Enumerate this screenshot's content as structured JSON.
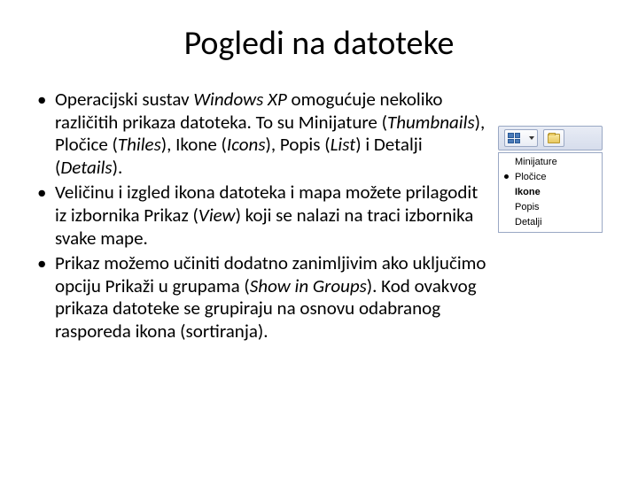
{
  "title": "Pogledi na datoteke",
  "bullets": [
    {
      "pre": "Operacijski sustav ",
      "i1": "Windows XP",
      "mid1": " omogućuje nekoliko različitih prikaza datoteka. To su Minijature (",
      "i2": "Thumbnails",
      "mid2": "), Pločice (",
      "i3": "Thiles",
      "mid3": "), Ikone (",
      "i4": "Icons",
      "mid4": "), Popis (",
      "i5": "List",
      "mid5": ") i Detalji (",
      "i6": "Details",
      "post": ")."
    },
    {
      "pre": "Veličinu i izgled ikona datoteka i mapa možete prilagodit iz izbornika Prikaz (",
      "i1": "View",
      "post": ") koji se nalazi na traci izbornika svake mape."
    },
    {
      "pre": "Prikaz možemo učiniti dodatno zanimljivim ako uključimo opciju Prikaži u grupama (",
      "i1": "Show in Groups",
      "post": "). Kod ovakvog prikaza datoteke se grupiraju na osnovu odabranog rasporeda ikona (sortiranja)."
    }
  ],
  "dropdown": {
    "items": [
      {
        "label": "Minijature",
        "selected": false,
        "bold": false
      },
      {
        "label": "Pločice",
        "selected": true,
        "bold": false
      },
      {
        "label": "Ikone",
        "selected": false,
        "bold": true
      },
      {
        "label": "Popis",
        "selected": false,
        "bold": false
      },
      {
        "label": "Detalji",
        "selected": false,
        "bold": false
      }
    ]
  },
  "bullet_dot": "•"
}
